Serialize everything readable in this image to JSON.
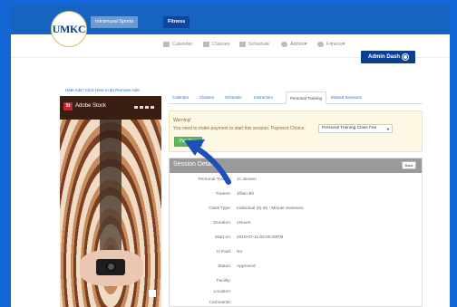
{
  "topbar": {
    "tabs": [
      {
        "label": "Intramural Sports"
      },
      {
        "label": "Fitness"
      }
    ]
  },
  "logo": {
    "text": "UMKC"
  },
  "nav": {
    "items": [
      {
        "label": "Calendar",
        "icon": "calendar-icon"
      },
      {
        "label": "Classes",
        "icon": "people-icon"
      },
      {
        "label": "Schedule",
        "icon": "chart-icon"
      },
      {
        "label": "Admin▾",
        "icon": "gear-icon"
      },
      {
        "label": "Fitness▾",
        "icon": "info-icon"
      }
    ]
  },
  "admin_dash": {
    "label": "Admin Dash"
  },
  "ad": {
    "link": "Hate Ads? Click Here to $4 Remove Ads!",
    "brand": "Adobe Stock",
    "logo": "St"
  },
  "main_tabs": [
    {
      "label": "Calendar"
    },
    {
      "label": "Classes"
    },
    {
      "label": "Schedule"
    },
    {
      "label": "Instructors"
    },
    {
      "label": "Personal Training"
    },
    {
      "label": "Missed Sessions"
    }
  ],
  "warning": {
    "title": "Warning!",
    "text": "You need to make payment to start this session. Payment Choice:",
    "select_value": "Personal Training Class Fee",
    "pay_button": "Pay Now"
  },
  "session": {
    "title": "Session Details",
    "back_label": "Back",
    "fields": [
      {
        "label": "Personal Trainer:",
        "value": "Jo Jensen"
      },
      {
        "label": "Trainee:",
        "value": "Jillian Bri"
      },
      {
        "label": "Class Type:",
        "value": "Individual (5) 60 - Minute Sessions"
      },
      {
        "label": "Duration:",
        "value": "1Hours"
      },
      {
        "label": "Start on:",
        "value": "2019-07-11 04:00:00PM"
      },
      {
        "label": "Is Paid:",
        "value": "No"
      },
      {
        "label": "Status:",
        "value": "Approved"
      },
      {
        "label": "Facility:",
        "value": ""
      },
      {
        "label": "Location:",
        "value": ""
      },
      {
        "label": "Comments:",
        "value": ""
      }
    ]
  },
  "colors": {
    "background": "#1366d6",
    "topbar": "#1565c0",
    "brand_navy": "#0b3d91",
    "pay_green": "#5cb85c",
    "warning_bg": "#fcf8e3",
    "arrow": "#1f4fb8"
  }
}
